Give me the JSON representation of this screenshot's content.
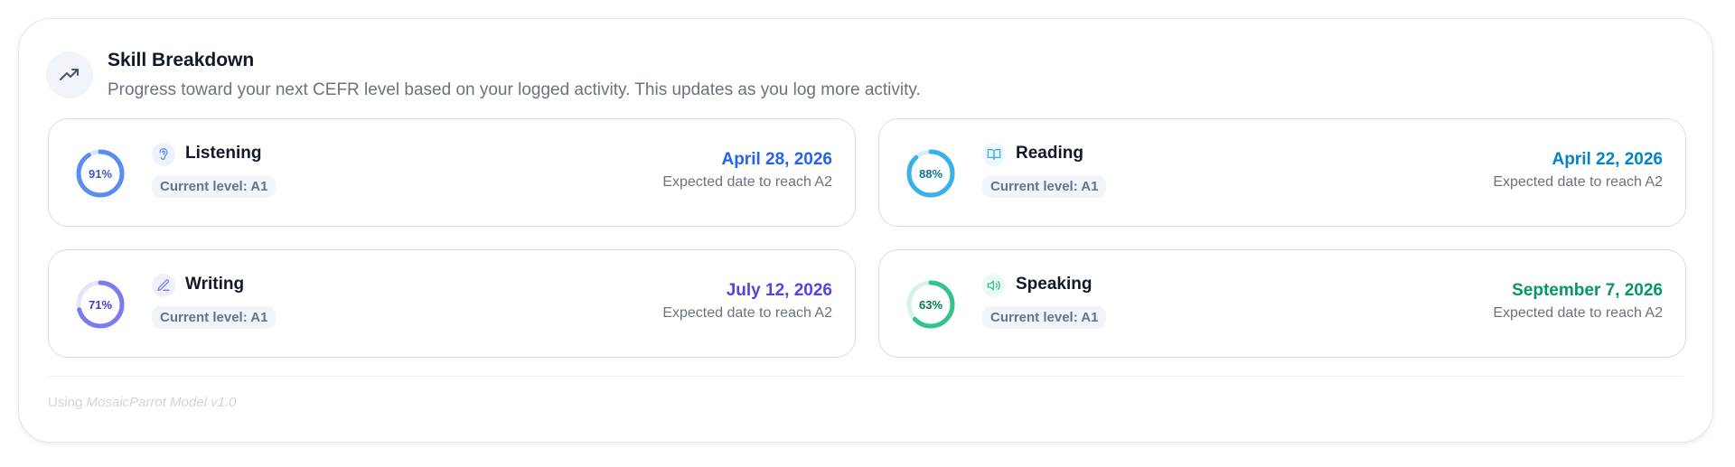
{
  "header": {
    "icon": "trending-up-icon",
    "title": "Skill Breakdown",
    "subtitle": "Progress toward your next CEFR level based on your logged activity. This updates as you log more activity."
  },
  "skills": [
    {
      "name": "Listening",
      "icon": "ear-icon",
      "percent_label": "91%",
      "progress": 0.91,
      "level": "Current level: A1",
      "date": "April 28, 2026",
      "date_caption": "Expected date to reach A2",
      "color": "#5b8def",
      "track": "#dbe6fb",
      "icon_bg": "#eef2fb",
      "date_color": "#2563eb",
      "pct_color": "#3b5bbd"
    },
    {
      "name": "Reading",
      "icon": "book-open-icon",
      "percent_label": "88%",
      "progress": 0.88,
      "level": "Current level: A1",
      "date": "April 22, 2026",
      "date_caption": "Expected date to reach A2",
      "color": "#38b2e8",
      "track": "#d7eef9",
      "icon_bg": "#eef7fc",
      "date_color": "#0284c7",
      "pct_color": "#0e7490"
    },
    {
      "name": "Writing",
      "icon": "pencil-icon",
      "percent_label": "71%",
      "progress": 0.71,
      "level": "Current level: A1",
      "date": "July 12, 2026",
      "date_caption": "Expected date to reach A2",
      "color": "#7c7cf0",
      "track": "#e4e4fb",
      "icon_bg": "#f0f0fd",
      "date_color": "#4f46e5",
      "pct_color": "#4338ca"
    },
    {
      "name": "Speaking",
      "icon": "speaker-icon",
      "percent_label": "63%",
      "progress": 0.63,
      "level": "Current level: A1",
      "date": "September 7, 2026",
      "date_caption": "Expected date to reach A2",
      "color": "#34c38f",
      "track": "#d6f3e8",
      "icon_bg": "#ecfaf4",
      "date_color": "#059669",
      "pct_color": "#047857"
    }
  ],
  "footer": {
    "prefix": "Using",
    "model": "MosaicParrot Model v1.0"
  }
}
